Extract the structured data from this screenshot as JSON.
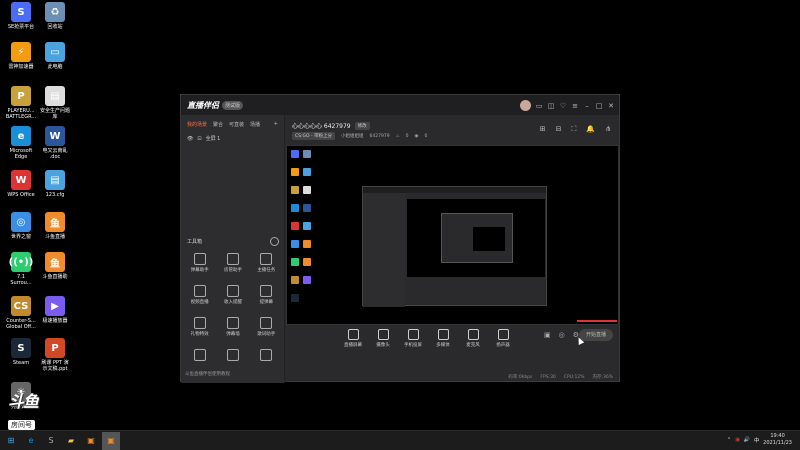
{
  "desktop": {
    "icons": [
      {
        "label": "SE抢票平台",
        "glyph": "S",
        "color": "#4a6cf7"
      },
      {
        "label": "回收站",
        "glyph": "♻",
        "color": "#6b8fb5"
      },
      {
        "label": "雷神加速器",
        "glyph": "⚡",
        "color": "#f39c12"
      },
      {
        "label": "此电脑",
        "glyph": "▭",
        "color": "#4aa3df"
      },
      {
        "label": "PLAYERU...\nBATTLEGR...",
        "glyph": "P",
        "color": "#c9a13b"
      },
      {
        "label": "安全生产问题\n库",
        "glyph": "▤",
        "color": "#dddddd"
      },
      {
        "label": "Microsoft\nEdge",
        "glyph": "e",
        "color": "#1a8fd9"
      },
      {
        "label": "电又云南乱\n.doc",
        "glyph": "W",
        "color": "#2b579a"
      },
      {
        "label": "WPS Office",
        "glyph": "W",
        "color": "#d33"
      },
      {
        "label": "123.cfg",
        "glyph": "▤",
        "color": "#4aa3df"
      },
      {
        "label": "世界之窗",
        "glyph": "◎",
        "color": "#3a8ee6"
      },
      {
        "label": "斗鱼直播",
        "glyph": "鱼",
        "color": "#f08a2a"
      },
      {
        "label": "7.1\nSurrou...",
        "glyph": "((•))",
        "color": "#2ecc71"
      },
      {
        "label": "斗鱼直播助",
        "glyph": "鱼",
        "color": "#f08a2a"
      },
      {
        "label": "Counter-S...\nGlobal Off...",
        "glyph": "CS",
        "color": "#c28a2d"
      },
      {
        "label": "极速播放器",
        "glyph": "▶",
        "color": "#7b5cf0"
      },
      {
        "label": "Steam",
        "glyph": "S",
        "color": "#1b2838"
      },
      {
        "label": "刷课 PPT 演\n示文稿.ppt",
        "glyph": "P",
        "color": "#d24726"
      },
      {
        "label": "亮度调节",
        "glyph": "☀",
        "color": "#666"
      }
    ]
  },
  "watermark": {
    "logo": "斗鱼",
    "room_label": "房间号",
    "room_number": "6427979"
  },
  "taskbar": {
    "time": "19:40",
    "date": "2021/11/23",
    "lang": "中",
    "volume": "🔊",
    "tray_extra": "⌃"
  },
  "app": {
    "brand": "直播伴侣",
    "brand_badge": "测试版",
    "left_tabs": [
      "我的场景",
      "聚合",
      "可直装",
      "场播"
    ],
    "scene_label": "全屏 1",
    "tools_title": "工具箱",
    "tools": [
      "弹幕助手",
      "房管助手",
      "主播任务",
      "视频直播",
      "收入提醒",
      "提弹幕",
      "礼物特效",
      "弹幕墙",
      "歌词助手",
      "",
      "",
      ""
    ],
    "footer_link": "斗鱼直播伴侣使用教程",
    "room_title": "心心心心心 6427979",
    "room_edit": "修改",
    "category": "CS:GO - 带粉上分",
    "host_label": "小姐姐姐姐",
    "room_id": "6427979",
    "likes": "0",
    "viewers": "0",
    "controls": [
      "直播屏幕",
      "摄像头",
      "手机投屏",
      "多媒体",
      "麦克风",
      "扬声器"
    ],
    "live_button": "开始直播",
    "status": [
      "码率:0kbps",
      "FPS:30",
      "CPU:12%",
      "内存:36%"
    ]
  }
}
